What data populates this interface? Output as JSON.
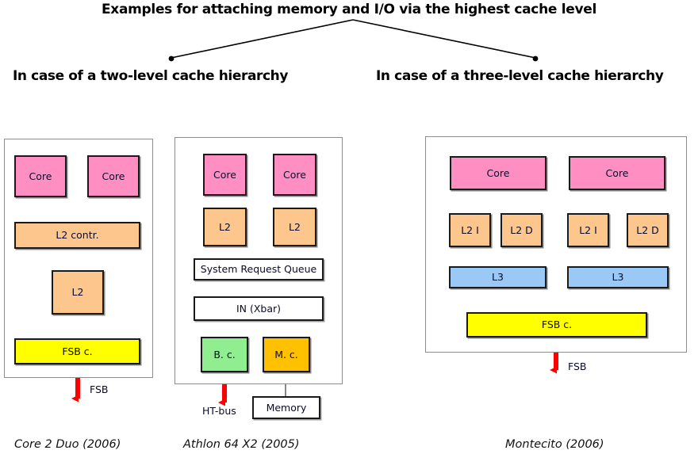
{
  "title": "Examples for attaching memory and I/O via the highest cache level",
  "branches": [
    {
      "label": "In case of a two-level cache hierarchy"
    },
    {
      "label": "In case of a three-level cache hierarchy"
    }
  ],
  "colors": {
    "core": "#FF8FC2",
    "cache": "#FCC68D",
    "l3": "#9AC9F5",
    "fsb": "#FFFF00",
    "bridge_controller": "#90EE90",
    "memory_controller": "#FFC000",
    "plain": "#FFFFFF",
    "arrow": "#FF0000",
    "panel_border": "#8D8D8D",
    "block_border": "#1A1A1A",
    "text": "#0A0A2A"
  },
  "diagrams": {
    "core2duo": {
      "caption": "Core 2 Duo (2006)",
      "blocks": {
        "core_left": "Core",
        "core_right": "Core",
        "l2_controller": "L2 contr.",
        "l2": "L2",
        "fsb_controller": "FSB c."
      },
      "bus_label": "FSB"
    },
    "athlon": {
      "caption": "Athlon 64 X2 (2005)",
      "blocks": {
        "core_left": "Core",
        "core_right": "Core",
        "l2_left": "L2",
        "l2_right": "L2",
        "system_request_queue": "System Request Queue",
        "interconnect": "IN (Xbar)",
        "bridge_controller": "B. c.",
        "memory_controller": "M. c.",
        "memory": "Memory"
      },
      "bus_label": "HT-bus"
    },
    "montecito": {
      "caption": "Montecito (2006)",
      "blocks": {
        "core_left": "Core",
        "core_right": "Core",
        "l2i_left": "L2 I",
        "l2d_left": "L2 D",
        "l2i_right": "L2 I",
        "l2d_right": "L2 D",
        "l3_left": "L3",
        "l3_right": "L3",
        "fsb_controller": "FSB c."
      },
      "bus_label": "FSB"
    }
  }
}
